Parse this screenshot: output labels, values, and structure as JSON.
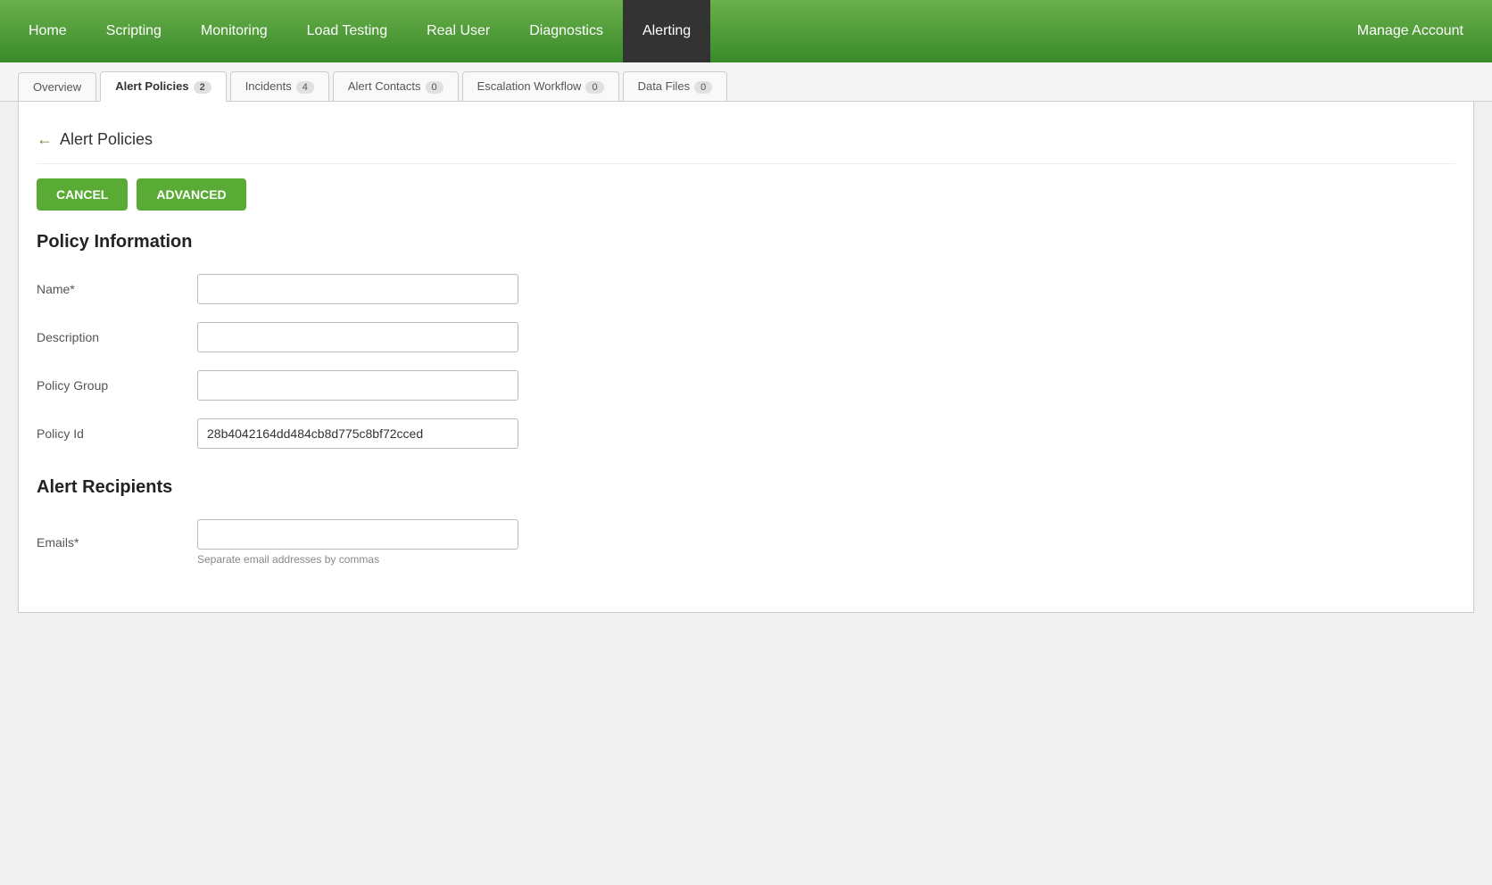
{
  "nav": {
    "items": [
      {
        "id": "home",
        "label": "Home",
        "active": false
      },
      {
        "id": "scripting",
        "label": "Scripting",
        "active": false
      },
      {
        "id": "monitoring",
        "label": "Monitoring",
        "active": false
      },
      {
        "id": "load-testing",
        "label": "Load Testing",
        "active": false
      },
      {
        "id": "real-user",
        "label": "Real User",
        "active": false
      },
      {
        "id": "diagnostics",
        "label": "Diagnostics",
        "active": false
      },
      {
        "id": "alerting",
        "label": "Alerting",
        "active": true
      }
    ],
    "manage_account_label": "Manage Account"
  },
  "tabs": [
    {
      "id": "overview",
      "label": "Overview",
      "badge": null,
      "active": false
    },
    {
      "id": "alert-policies",
      "label": "Alert Policies",
      "badge": "2",
      "active": true
    },
    {
      "id": "incidents",
      "label": "Incidents",
      "badge": "4",
      "active": false
    },
    {
      "id": "alert-contacts",
      "label": "Alert Contacts",
      "badge": "0",
      "active": false
    },
    {
      "id": "escalation-workflow",
      "label": "Escalation Workflow",
      "badge": "0",
      "active": false
    },
    {
      "id": "data-files",
      "label": "Data Files",
      "badge": "0",
      "active": false
    }
  ],
  "breadcrumb": {
    "back_arrow": "←",
    "title": "Alert Policies"
  },
  "buttons": {
    "cancel_label": "CANCEL",
    "advanced_label": "ADVANCED"
  },
  "policy_info": {
    "section_title": "Policy Information",
    "fields": [
      {
        "id": "name",
        "label": "Name*",
        "value": "",
        "placeholder": "",
        "hint": ""
      },
      {
        "id": "description",
        "label": "Description",
        "value": "",
        "placeholder": "",
        "hint": ""
      },
      {
        "id": "policy-group",
        "label": "Policy Group",
        "value": "",
        "placeholder": "",
        "hint": ""
      },
      {
        "id": "policy-id",
        "label": "Policy Id",
        "value": "28b4042164dd484cb8d775c8bf72cced",
        "placeholder": "",
        "hint": ""
      }
    ]
  },
  "alert_recipients": {
    "section_title": "Alert Recipients",
    "fields": [
      {
        "id": "emails",
        "label": "Emails*",
        "value": "",
        "placeholder": "",
        "hint": "Separate email addresses by commas"
      }
    ]
  }
}
